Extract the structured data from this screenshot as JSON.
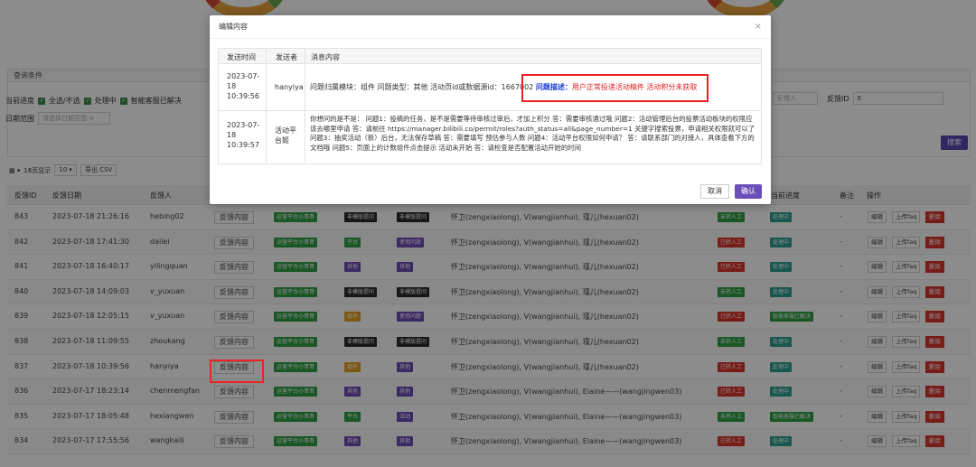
{
  "filter": {
    "panel_title": "查询条件",
    "progress_label": "当前进度",
    "options": [
      "全选/不选",
      "处理中",
      "智能客服已解决"
    ],
    "date_label": "日期范围",
    "date_placeholder": "请选择日期范围",
    "reporter_placeholder": "反馈人",
    "feedback_id_label": "反馈ID",
    "feedback_id_value": "0",
    "search_label": "搜索"
  },
  "toolbar": {
    "page_size_prefix": "16页显示",
    "page_size": "10",
    "export_label": "导出 CSV"
  },
  "table": {
    "columns": {
      "id": "反馈ID",
      "date": "反馈日期",
      "reporter": "反馈人",
      "progress": "当前进度",
      "note": "备注",
      "ops": "操作"
    },
    "feedback_btn": "反馈内容",
    "edit_btn": "编辑",
    "faq_btn": "上传faq",
    "del_btn": "删除",
    "rows": [
      {
        "id": "843",
        "date": "2023-07-18 21:26:16",
        "user": "hebing02",
        "t1": "运营平台小哥哥",
        "t2": "非模版提问",
        "t3": "非模版提问",
        "handlers": "怀卫(zengxiaolong), V(wangjianhui), 瑾儿(hexuan02)",
        "s1": "未转人工",
        "s2": "处理中",
        "note": "-"
      },
      {
        "id": "842",
        "date": "2023-07-18 17:41:30",
        "user": "dailei",
        "t1": "运营平台小哥哥",
        "t2": "平台",
        "t3": "使用问题",
        "handlers": "怀卫(zengxiaolong), V(wangjianhui), 瑾儿(hexuan02)",
        "s1": "已转人工",
        "s2": "处理中",
        "note": "-"
      },
      {
        "id": "841",
        "date": "2023-07-18 16:40:17",
        "user": "yilingquan",
        "t1": "运营平台小哥哥",
        "t2": "其他",
        "t3": "其他",
        "handlers": "怀卫(zengxiaolong), V(wangjianhui), 瑾儿(hexuan02)",
        "s1": "已转人工",
        "s2": "处理中",
        "note": "-"
      },
      {
        "id": "840",
        "date": "2023-07-18 14:09:03",
        "user": "v_yuxuan",
        "t1": "运营平台小哥哥",
        "t2": "非模版提问",
        "t3": "非模版提问",
        "handlers": "怀卫(zengxiaolong), V(wangjianhui), 瑾儿(hexuan02)",
        "s1": "未转人工",
        "s2": "处理中",
        "note": "-"
      },
      {
        "id": "839",
        "date": "2023-07-18 12:05:15",
        "user": "v_yuxuan",
        "t1": "运营平台小哥哥",
        "t2": "组件",
        "t3": "使用问题",
        "handlers": "怀卫(zengxiaolong), V(wangjianhui), 瑾儿(hexuan02)",
        "s1": "已转人工",
        "s2": "智能客服已解决",
        "note": "-"
      },
      {
        "id": "838",
        "date": "2023-07-18 11:09:55",
        "user": "zhoukang",
        "t1": "运营平台小哥哥",
        "t2": "非模版提问",
        "t3": "非模版提问",
        "handlers": "怀卫(zengxiaolong), V(wangjianhui), 瑾儿(hexuan02)",
        "s1": "未转人工",
        "s2": "处理中",
        "note": "-"
      },
      {
        "id": "837",
        "date": "2023-07-18 10:39:56",
        "user": "hanyiya",
        "t1": "运营平台小哥哥",
        "t2": "组件",
        "t3": "其他",
        "handlers": "怀卫(zengxiaolong), V(wangjianhui), 瑾儿(hexuan02)",
        "s1": "已转人工",
        "s2": "处理中",
        "note": "-"
      },
      {
        "id": "836",
        "date": "2023-07-17 18:23:14",
        "user": "chenmengfan",
        "t1": "运营平台小哥哥",
        "t2": "其他",
        "t3": "其他",
        "handlers": "怀卫(zengxiaolong), V(wangjianhui), Elaine——(wangjingwen03)",
        "s1": "已转人工",
        "s2": "处理中",
        "note": "-"
      },
      {
        "id": "835",
        "date": "2023-07-17 18:05:48",
        "user": "hexiangwen",
        "t1": "运营平台小哥哥",
        "t2": "平台",
        "t3": "活动",
        "handlers": "怀卫(zengxiaolong), V(wangjianhui), Elaine——(wangjingwen03)",
        "s1": "未转人工",
        "s2": "智能客服已解决",
        "note": "-"
      },
      {
        "id": "834",
        "date": "2023-07-17 17:55:56",
        "user": "wangkaili",
        "t1": "运营平台小哥哥",
        "t2": "其他",
        "t3": "其他",
        "handlers": "怀卫(zengxiaolong), V(wangjianhui), Elaine——(wangjingwen03)",
        "s1": "已转人工",
        "s2": "处理中",
        "note": "-"
      }
    ]
  },
  "modal": {
    "title": "编辑内容",
    "columns": {
      "time": "发送时间",
      "sender": "发送者",
      "content": "消息内容"
    },
    "rows": [
      {
        "time_lines": [
          "2023-07-",
          "18",
          "10:39:56"
        ],
        "sender": "hanyiya",
        "content_prefix": "问题归属模块：组件 问题类型：其他 活动页id或数据源id：1667002 ",
        "content_label": "问题描述：",
        "content_highlight": "用户正常投递活动稿件 活动积分未获取"
      },
      {
        "time_lines": [
          "2023-07-",
          "18",
          "10:39:57"
        ],
        "sender_lines": [
          "活动平",
          "台姬"
        ],
        "content": "你想问的是不是： 问题1：投稿的任务，是不是需要等待审核过审后，才加上积分 答：需要审核通过哦 问题2：活动管理后台的投票活动板块的权限应该去哪里申请 答：请前往 https://manager.bilibili.co/permit/roles?auth_status=all&page_number=1 关键字搜索投票，申请相关权限就可以了 问题3：抽奖活动（新）后台，无法保存草稿 答：需要填写 预估参与人数 问题4：活动平台权限如何申请？ 答：请联系部门的对接人，具体查看下方的文档哦 问题5：页面上的计数组件点击提示 活动未开始 答：请检查是否配置活动开始的时间"
      }
    ],
    "cancel_label": "取消",
    "confirm_label": "确认"
  },
  "colors": {
    "green_tag": "#2f9e44",
    "black_tag": "#2b2b2b",
    "purple_tag": "#6a4bb5",
    "yellow_tag": "#e0a020",
    "red_tag": "#d9342b",
    "teal_tag": "#2a9e8f",
    "accent": "#6b4fb8",
    "highlight_box": "#e22222"
  }
}
